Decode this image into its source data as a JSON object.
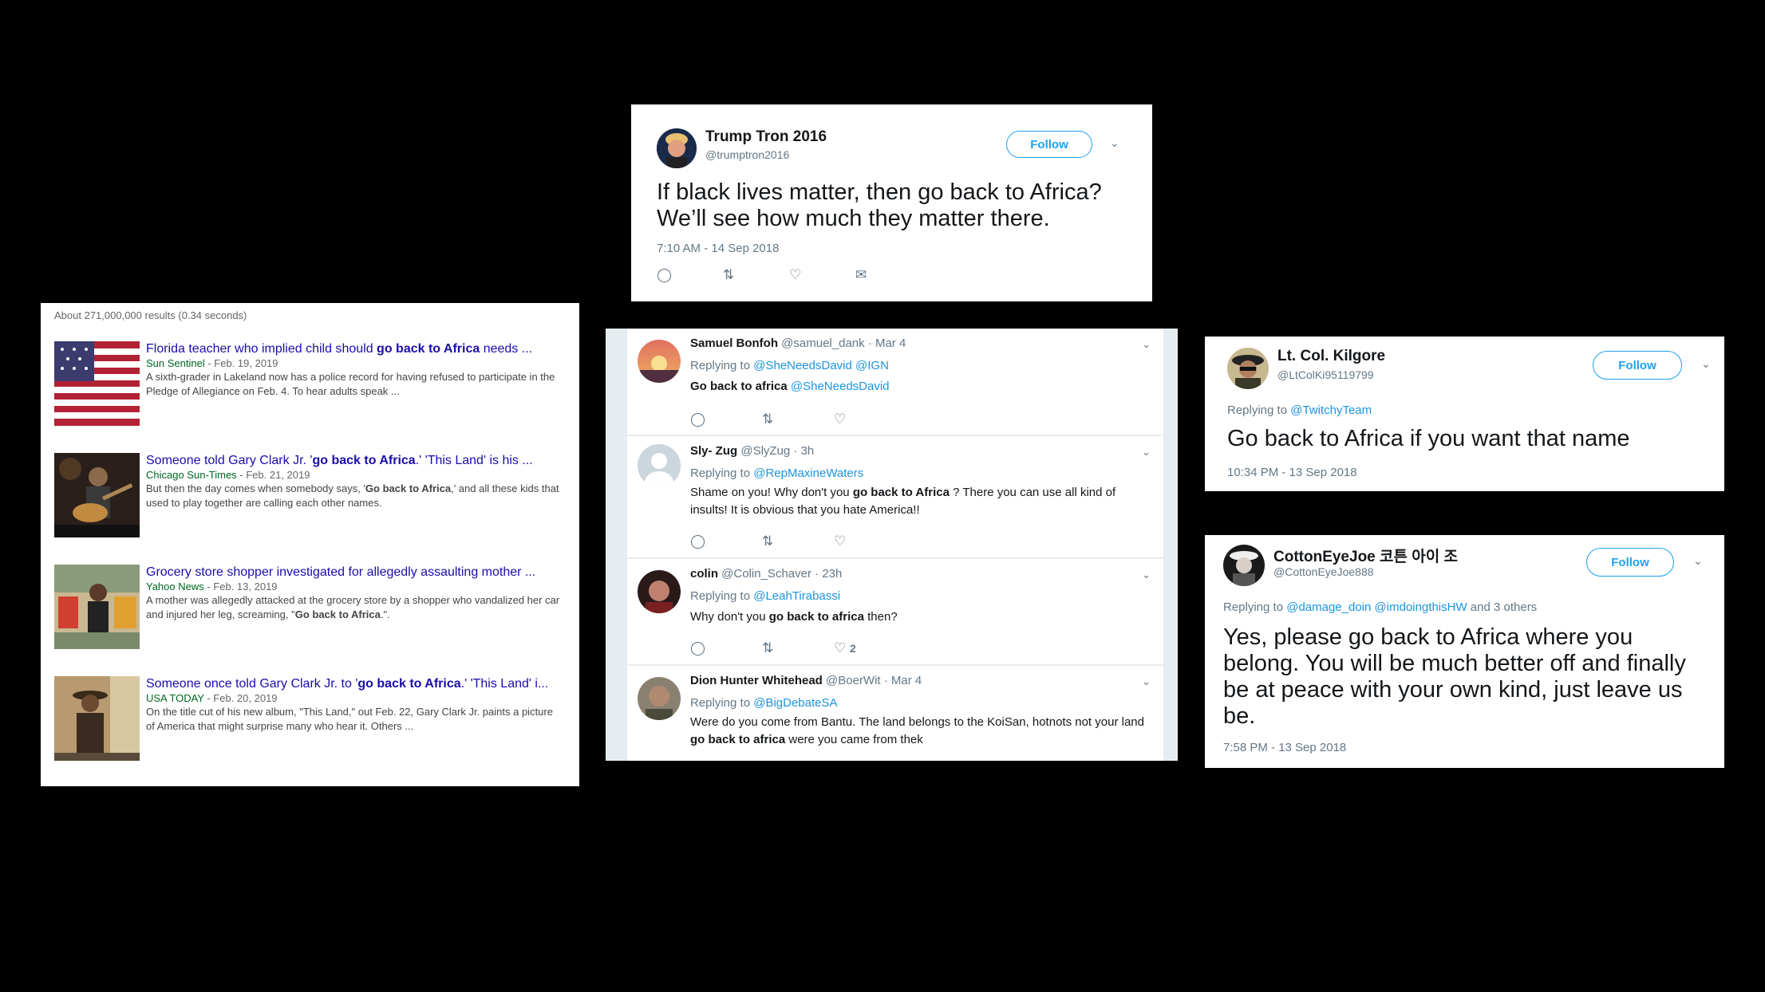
{
  "google": {
    "stats": "About 271,000,000 results (0.34 seconds)",
    "results": [
      {
        "title_pre": "Florida teacher who implied child should ",
        "title_bold": "go back to Africa",
        "title_post": " needs ...",
        "source": "Sun Sentinel",
        "date": " - Feb. 19, 2019",
        "snippet": "A sixth-grader in Lakeland now has a police record for having refused to participate in the Pledge of Allegiance on Feb. 4. To hear adults speak ..."
      },
      {
        "title_pre": "Someone told Gary Clark Jr. '",
        "title_bold": "go back to Africa",
        "title_post": ".' 'This Land' is his ...",
        "source": "Chicago Sun-Times",
        "date": " - Feb. 21, 2019",
        "snippet_pre": "But then the day comes when somebody says, '",
        "snippet_bold": "Go back to Africa",
        "snippet_post": ",' and all these kids that used to play together are calling each other names."
      },
      {
        "title_pre": "Grocery store shopper investigated for allegedly assaulting mother ...",
        "title_bold": "",
        "title_post": "",
        "source": "Yahoo News",
        "date": " - Feb. 13, 2019",
        "snippet_pre": "A mother was allegedly attacked at the grocery store by a shopper who vandalized her car and injured her leg, screaming, \"",
        "snippet_bold": "Go back to Africa",
        "snippet_post": ".\"."
      },
      {
        "title_pre": "Someone once told Gary Clark Jr. to '",
        "title_bold": "go back to Africa",
        "title_post": ".' 'This Land' i...",
        "source": "USA TODAY",
        "date": " - Feb. 20, 2019",
        "snippet": "On the title cut of his new album, \"This Land,\" out Feb. 22, Gary Clark Jr. paints a picture of America that might surprise many who hear it. Others ..."
      }
    ]
  },
  "tweet_trump": {
    "name": "Trump Tron 2016",
    "handle": "@trumptron2016",
    "follow": "Follow",
    "text": "If black lives matter, then go back to Africa? We’ll see how much they matter there.",
    "time": "7:10 AM - 14 Sep 2018"
  },
  "thread": [
    {
      "name": "Samuel Bonfoh",
      "handle": " @samuel_dank · Mar 4",
      "replying": "Replying to ",
      "reply_links": "@SheNeedsDavid @IGN",
      "text_bold": "Go back to africa",
      "text_link": " @SheNeedsDavid"
    },
    {
      "name": "Sly- Zug",
      "handle": " @SlyZug · 3h",
      "replying": "Replying to ",
      "reply_links": "@RepMaxineWaters",
      "text_pre": "Shame on you! Why don't you ",
      "text_bold": "go back to Africa",
      "text_post": " ? There you can use all kind of insults! It is obvious that you hate America!!"
    },
    {
      "name": "colin",
      "handle": " @Colin_Schaver · 23h",
      "replying": "Replying to ",
      "reply_links": "@LeahTirabassi",
      "text_pre": "Why don't you ",
      "text_bold": "go back to africa",
      "text_post": " then?",
      "likes": "2"
    },
    {
      "name": "Dion Hunter Whitehead",
      "handle": " @BoerWit · Mar 4",
      "replying": "Replying to ",
      "reply_links": "@BigDebateSA",
      "text_pre": "Were do you come from Bantu. The land belongs to the KoiSan, hotnots not your land ",
      "text_bold": "go back to africa",
      "text_post": " were you came from thek"
    }
  ],
  "tweet_kilgore": {
    "name": "Lt. Col. Kilgore",
    "handle": "@LtColKi95119799",
    "follow": "Follow",
    "replying": "Replying to ",
    "reply_link": "@TwitchyTeam",
    "text": "Go back to Africa if you want that name",
    "time": "10:34 PM - 13 Sep 2018"
  },
  "tweet_cotton": {
    "name": "CottonEyeJoe 코튼 아이 조",
    "handle": "@CottonEyeJoe888",
    "follow": "Follow",
    "replying": "Replying to ",
    "reply_links": "@damage_doin @imdoingthisHW",
    "reply_others": " and 3 others",
    "text": "Yes, please go back to Africa where you belong. You will be much better off and finally be at peace with your own kind, just leave us be.",
    "time": "7:58 PM - 13 Sep 2018"
  }
}
